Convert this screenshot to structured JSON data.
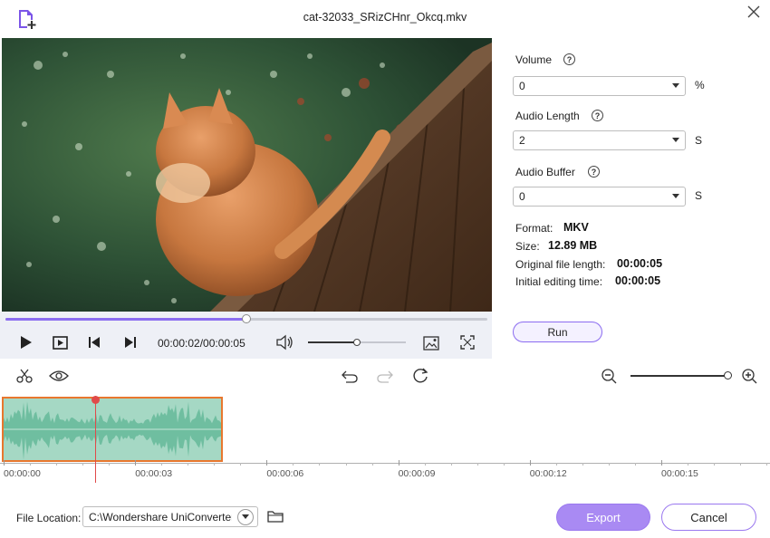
{
  "window": {
    "title": "cat-32033_SRizCHnr_Okcq.mkv"
  },
  "player": {
    "time": "00:00:02/00:00:05",
    "seek_progress": 0.5,
    "volume_level": 0.5
  },
  "settings": {
    "volume": {
      "label": "Volume",
      "value": "0",
      "unit": "%"
    },
    "audio_length": {
      "label": "Audio Length",
      "value": "2",
      "unit": "S"
    },
    "audio_buffer": {
      "label": "Audio Buffer",
      "value": "0",
      "unit": "S"
    }
  },
  "info": {
    "format_label": "Format:",
    "format_value": "MKV",
    "size_label": "Size:",
    "size_value": "12.89 MB",
    "original_length_label": "Original file length:",
    "original_length_value": "00:00:05",
    "initial_editing_label": "Initial editing time:",
    "initial_editing_value": "00:00:05"
  },
  "run_label": "Run",
  "timeline": {
    "ticks": [
      "00:00:00",
      "00:00:03",
      "00:00:06",
      "00:00:09",
      "00:00:12",
      "00:00:15"
    ],
    "zoom_level": 1.0
  },
  "footer": {
    "file_location_label": "File Location:",
    "path": "C:\\Wondershare UniConverter",
    "export_label": "Export",
    "cancel_label": "Cancel"
  },
  "colors": {
    "accent": "#8c6ef0",
    "clip_border": "#e8772e",
    "waveform": "#6fbea0",
    "playhead": "#e04a4a"
  }
}
